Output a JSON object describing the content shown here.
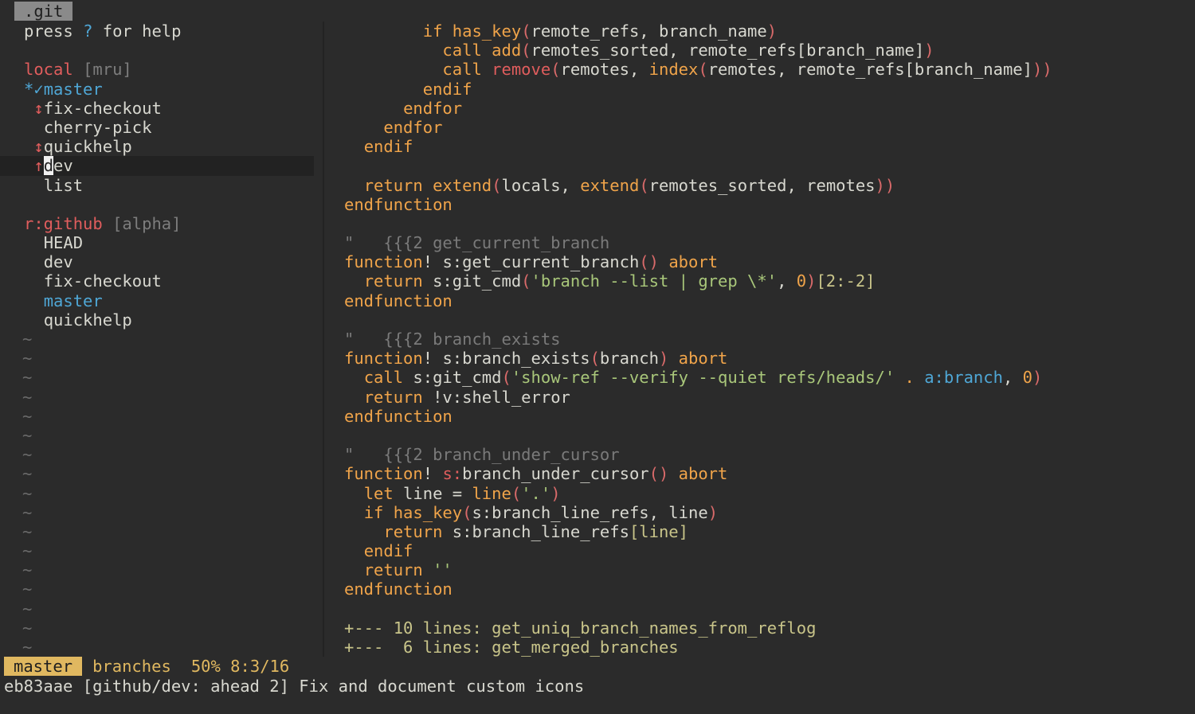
{
  "tab": {
    "label": ".git"
  },
  "branches": {
    "help_prefix": "press ",
    "help_key": "?",
    "help_suffix": " for help",
    "local": {
      "label": "local",
      "sort": "[mru]"
    },
    "local_items": [
      {
        "marker": "*✓",
        "name": "master",
        "current": true
      },
      {
        "marker": "↕",
        "name": "fix-checkout"
      },
      {
        "marker": " ",
        "name": "cherry-pick"
      },
      {
        "marker": "↕",
        "name": "quickhelp"
      },
      {
        "marker": "↑",
        "cursor_char": "d",
        "name_rest": "ev",
        "selected": true
      },
      {
        "marker": " ",
        "name": "list"
      }
    ],
    "remote": {
      "label": "r:github",
      "sort": "[alpha]"
    },
    "remote_items": [
      "HEAD",
      "dev",
      "fix-checkout",
      "master",
      "quickhelp"
    ],
    "tilde": "~",
    "tilde_count": 17
  },
  "code": {
    "l1": [
      "if",
      "has_key",
      "(",
      "remote_refs, branch_name",
      ")"
    ],
    "l2": [
      "call",
      "add",
      "(",
      "remotes_sorted, remote_refs[branch_name]",
      ")"
    ],
    "l3": [
      "call",
      "remove",
      "(",
      "remotes, ",
      "index",
      "(",
      "remotes, remote_refs[branch_name]",
      "))"
    ],
    "l4": "endif",
    "l5": "endfor",
    "l6": "endfor",
    "l7": "endif",
    "l8": [
      "return",
      "extend",
      "(",
      "locals, ",
      "extend",
      "(",
      "remotes_sorted, remotes",
      "))"
    ],
    "l9": "endfunction",
    "c1": "\"   {{{2 get_current_branch",
    "f1": [
      "function",
      "! ",
      "s:",
      "get_current_branch",
      "()",
      " abort"
    ],
    "r1": [
      "return",
      " s:git_cmd",
      "(",
      "'branch --list | grep \\*'",
      ", ",
      "0",
      ")",
      "[2:-2]"
    ],
    "e1": "endfunction",
    "c2": "\"   {{{2 branch_exists",
    "f2": [
      "function",
      "! ",
      "s:",
      "branch_exists",
      "(",
      "branch",
      ")",
      " abort"
    ],
    "k2": [
      "call",
      " s:git_cmd",
      "(",
      "'show-ref --verify --quiet refs/heads/'",
      " . ",
      "a:branch",
      ", ",
      "0",
      ")"
    ],
    "r2": [
      "return",
      " !v:shell_error"
    ],
    "e2": "endfunction",
    "c3": "\"   {{{2 branch_under_cursor",
    "f3": [
      "function",
      "! ",
      "s:",
      "branch_under_cursor",
      "()",
      " abort"
    ],
    "t1": [
      "let",
      " line = ",
      "line",
      "(",
      "'.'",
      ")"
    ],
    "t2": [
      "if",
      " ",
      "has_key",
      "(",
      "s:branch_line_refs, line",
      ")"
    ],
    "t3": [
      "return",
      " s:branch_line_refs",
      "[line]"
    ],
    "t4": "endif",
    "t5": [
      "return",
      " ''"
    ],
    "e3": "endfunction",
    "fold1": "+--- 10 lines: get_uniq_branch_names_from_reflog",
    "fold2": "+---  6 lines: get_merged_branches"
  },
  "statusline": {
    "mode": "master",
    "name": "branches",
    "position": "50% 8:3/16"
  },
  "cmdline": "eb83aae [github/dev: ahead 2] Fix and document custom icons"
}
